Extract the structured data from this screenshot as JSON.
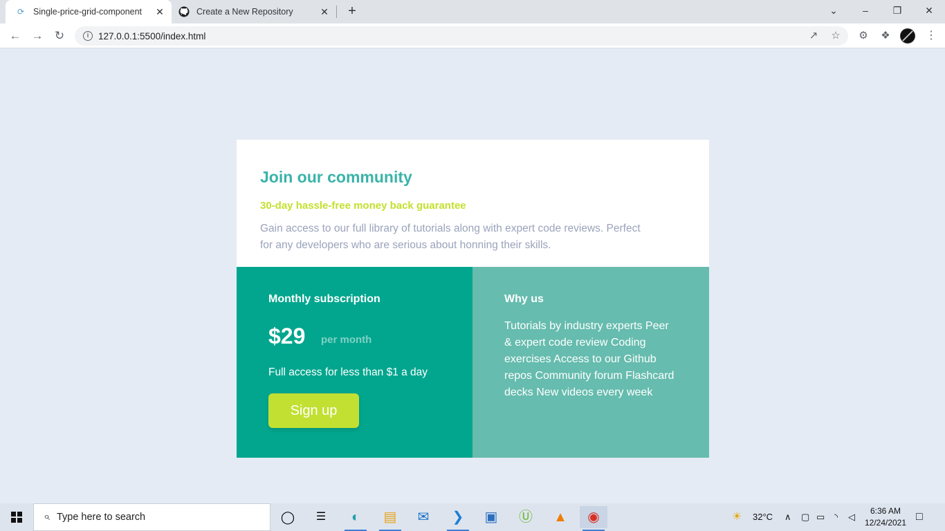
{
  "browser": {
    "tabs": [
      {
        "label": "Single-price-grid-component",
        "favicon": "spinner-icon",
        "active": true
      },
      {
        "label": "Create a New Repository",
        "favicon": "github-icon",
        "active": false
      }
    ],
    "url": "127.0.0.1:5500/index.html"
  },
  "card": {
    "title": "Join our community",
    "guarantee": "30-day hassle-free money back guarantee",
    "description": "Gain access to our full library of tutorials along with expert code reviews. Perfect for any developers who are serious about honning their skills.",
    "subscription": {
      "title": "Monthly subscription",
      "price": "$29",
      "period": "per month",
      "note": "Full access for less than $1 a day",
      "button": "Sign up"
    },
    "why": {
      "title": "Why us",
      "text": "Tutorials by industry experts Peer & expert code review Coding exercises Access to our Github repos Community forum Flashcard decks New videos every week"
    }
  },
  "taskbar": {
    "search_placeholder": "Type here to search",
    "temperature": "32°C",
    "time": "6:36 AM",
    "date": "12/24/2021"
  },
  "colors": {
    "accent_teal": "#3ab3a8",
    "guarantee_lime": "#c4e02e",
    "left_panel": "#02a68e",
    "right_panel": "#66bcae",
    "button": "#c1e032",
    "page_bg": "#e4ebf4"
  }
}
